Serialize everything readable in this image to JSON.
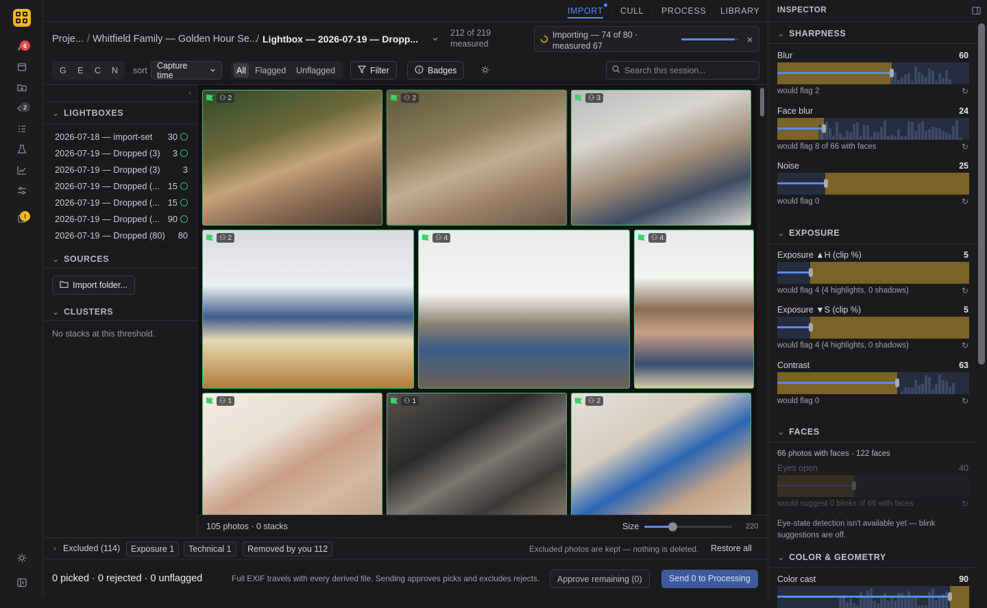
{
  "rail": {
    "badge_red": "6",
    "badge_gray": "2",
    "badge_amber": "!"
  },
  "nav": {
    "import": "IMPORT",
    "cull": "CULL",
    "process": "PROCESS",
    "library": "LIBRARY"
  },
  "breadcrumb": {
    "project": "Proje...",
    "sep1": "/",
    "session": "Whitfield Family — Golden Hour Se...",
    "sep2": "/",
    "lightbox": "Lightbox — 2026-07-19 — Dropp..."
  },
  "measured": {
    "line1": "212 of 219",
    "line2": "measured"
  },
  "importing": {
    "line1": "Importing — 74 of 80 ·",
    "line2": "measured 67",
    "progress": 0.925
  },
  "toolbar": {
    "modes": [
      "G",
      "E",
      "C",
      "N"
    ],
    "sort_label": "sort",
    "sort_value": "Capture time",
    "filters": [
      "All",
      "Flagged",
      "Unflagged"
    ],
    "filter_button": "Filter",
    "badges_button": "Badges",
    "search_placeholder": "Search this session..."
  },
  "sidebar": {
    "lightboxes_title": "LIGHTBOXES",
    "lightboxes": [
      {
        "name": "2026-07-18 — import-set",
        "count": "30"
      },
      {
        "name": "2026-07-19 — Dropped (3)",
        "count": "3"
      },
      {
        "name": "2026-07-19 — Dropped (3)",
        "count": "3"
      },
      {
        "name": "2026-07-19 — Dropped (...",
        "count": "15"
      },
      {
        "name": "2026-07-19 — Dropped (...",
        "count": "15"
      },
      {
        "name": "2026-07-19 — Dropped (...",
        "count": "90"
      },
      {
        "name": "2026-07-19 — Dropped (80)",
        "count": "80"
      }
    ],
    "sources_title": "SOURCES",
    "import_folder": "Import folder...",
    "clusters_title": "CLUSTERS",
    "clusters_empty": "No stacks at this threshold."
  },
  "photos": [
    {
      "faces": "2"
    },
    {
      "faces": "2"
    },
    {
      "faces": "3"
    },
    {
      "faces": "2"
    },
    {
      "faces": "4"
    },
    {
      "faces": "4"
    },
    {
      "faces": "1"
    },
    {
      "faces": "1"
    },
    {
      "faces": "2"
    }
  ],
  "grid_footer": {
    "summary": "105 photos · 0 stacks",
    "size_label": "Size",
    "size_value": "220",
    "size_fraction": 0.32
  },
  "excluded": {
    "label": "Excluded (114)",
    "chips": [
      "Exposure 1",
      "Technical 1",
      "Removed by you 112"
    ],
    "note": "Excluded photos are kept — nothing is deleted.",
    "restore": "Restore all"
  },
  "actions": {
    "summary": "0 picked · 0 rejected · 0 unflagged",
    "note": "Full EXIF travels with every derived file.  Sending approves picks and excludes rejects.",
    "approve": "Approve remaining (0)",
    "send": "Send 0 to Processing"
  },
  "inspector": {
    "title": "INSPECTOR",
    "sharpness_title": "SHARPNESS",
    "blur": {
      "label": "Blur",
      "value": "60",
      "note": "would flag 2"
    },
    "face_blur": {
      "label": "Face blur",
      "value": "24",
      "note": "would flag 8 of 66 with faces"
    },
    "noise": {
      "label": "Noise",
      "value": "25",
      "note": "would flag 0"
    },
    "exposure_title": "EXPOSURE",
    "exp_h": {
      "label": "Exposure ▲H (clip %)",
      "value": "5",
      "note": "would flag 4 (4 highlights, 0 shadows)"
    },
    "exp_s": {
      "label": "Exposure ▼S (clip %)",
      "value": "5",
      "note": "would flag 4 (4 highlights, 0 shadows)"
    },
    "contrast": {
      "label": "Contrast",
      "value": "63",
      "note": "would flag 0"
    },
    "faces_title": "FACES",
    "faces_summary": "66 photos with faces · 122 faces",
    "eyes": {
      "label": "Eyes open",
      "value": "40",
      "note": "would suggest 0 blinks of 66 with faces"
    },
    "eye_note": "Eye-state detection isn't available yet — blink suggestions are off.",
    "color_title": "COLOR & GEOMETRY",
    "color_cast": {
      "label": "Color cast",
      "value": "90"
    }
  },
  "colors": {
    "accent": "#5b8bf0",
    "flag_green": "#3fd06b",
    "warning_amber": "#f2b721",
    "danger_red": "#e5484d"
  }
}
